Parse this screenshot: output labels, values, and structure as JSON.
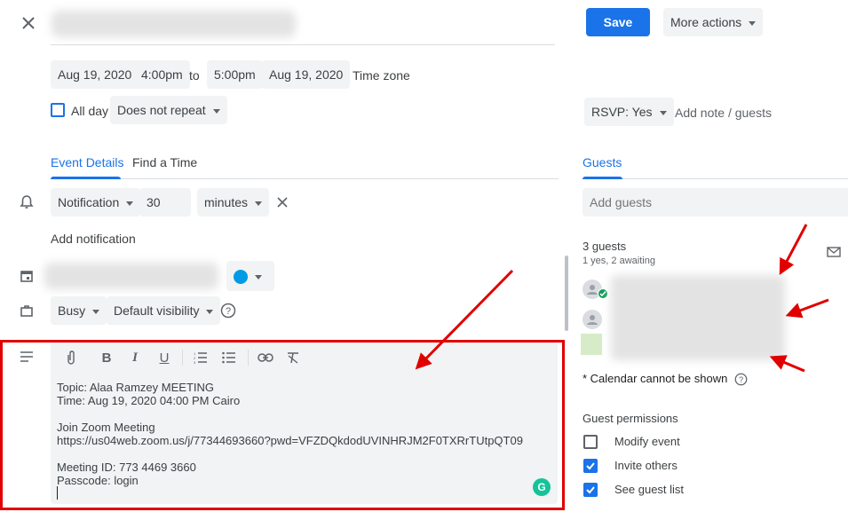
{
  "header": {
    "save_label": "Save",
    "more_actions_label": "More actions"
  },
  "datetime": {
    "start_date": "Aug 19, 2020",
    "start_time": "4:00pm",
    "to_label": "to",
    "end_time": "5:00pm",
    "end_date": "Aug 19, 2020",
    "timezone_label": "Time zone",
    "all_day_label": "All day",
    "repeat_value": "Does not repeat"
  },
  "tabs": {
    "event_details": "Event Details",
    "find_a_time": "Find a Time"
  },
  "notification": {
    "type_value": "Notification",
    "amount_value": "30",
    "unit_value": "minutes",
    "add_label": "Add notification"
  },
  "availability": {
    "busy_value": "Busy",
    "visibility_value": "Default visibility"
  },
  "description": {
    "lines": [
      "Topic: Alaa Ramzey MEETING",
      "Time: Aug 19, 2020 04:00 PM Cairo",
      "",
      "Join Zoom Meeting",
      "https://us04web.zoom.us/j/77344693660?pwd=VFZDQkdodUVINHRJM2F0TXRrTUtpQT09",
      "",
      "Meeting ID: 773 4469 3660",
      "Passcode: login"
    ]
  },
  "rsvp": {
    "value": "RSVP: Yes",
    "add_note_label": "Add note / guests"
  },
  "guests": {
    "tab_label": "Guests",
    "add_placeholder": "Add guests",
    "count_label": "3 guests",
    "summary": "1 yes, 2 awaiting",
    "calendar_note": "* Calendar cannot be shown",
    "permissions_title": "Guest permissions",
    "permissions": [
      {
        "label": "Modify event",
        "checked": false
      },
      {
        "label": "Invite others",
        "checked": true
      },
      {
        "label": "See guest list",
        "checked": true
      }
    ]
  },
  "colors": {
    "accent": "#1a73e8",
    "annotation": "#e00000",
    "event_color": "#039be5",
    "chip_bg": "#f1f3f4"
  }
}
